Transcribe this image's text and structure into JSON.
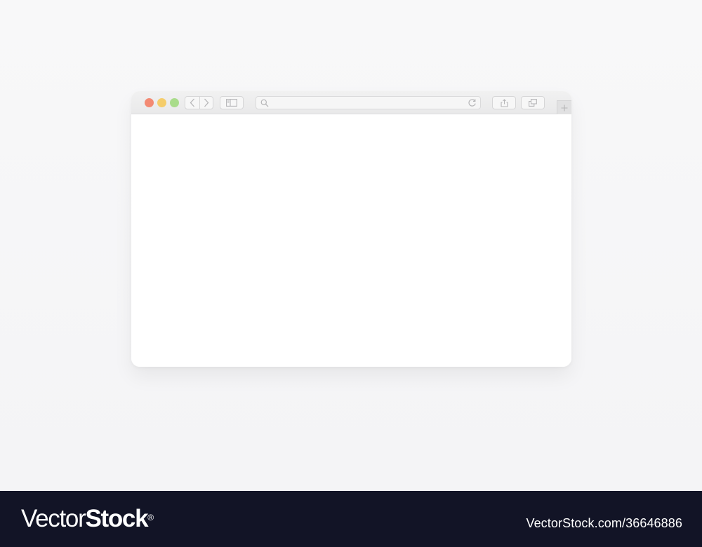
{
  "colors": {
    "close": "#f38a73",
    "minimize": "#f5cd6b",
    "maximize": "#a9dc8b",
    "footer_bg": "#121426",
    "toolbar_icon": "#b5b5b7"
  },
  "toolbar": {
    "traffic_lights": [
      "close",
      "minimize",
      "maximize"
    ],
    "nav": {
      "back_icon": "chevron-left-icon",
      "forward_icon": "chevron-right-icon"
    },
    "sidebar_icon": "sidebar-icon",
    "address": {
      "value": "",
      "placeholder": "",
      "search_icon": "search-icon",
      "reload_icon": "reload-icon"
    },
    "share_icon": "share-icon",
    "tabs_icon": "tabs-icon",
    "new_tab_icon": "plus-icon"
  },
  "footer": {
    "brand_light": "Vector",
    "brand_bold": "Stock",
    "brand_mark": "®",
    "image_ref": "VectorStock.com/36646886"
  }
}
